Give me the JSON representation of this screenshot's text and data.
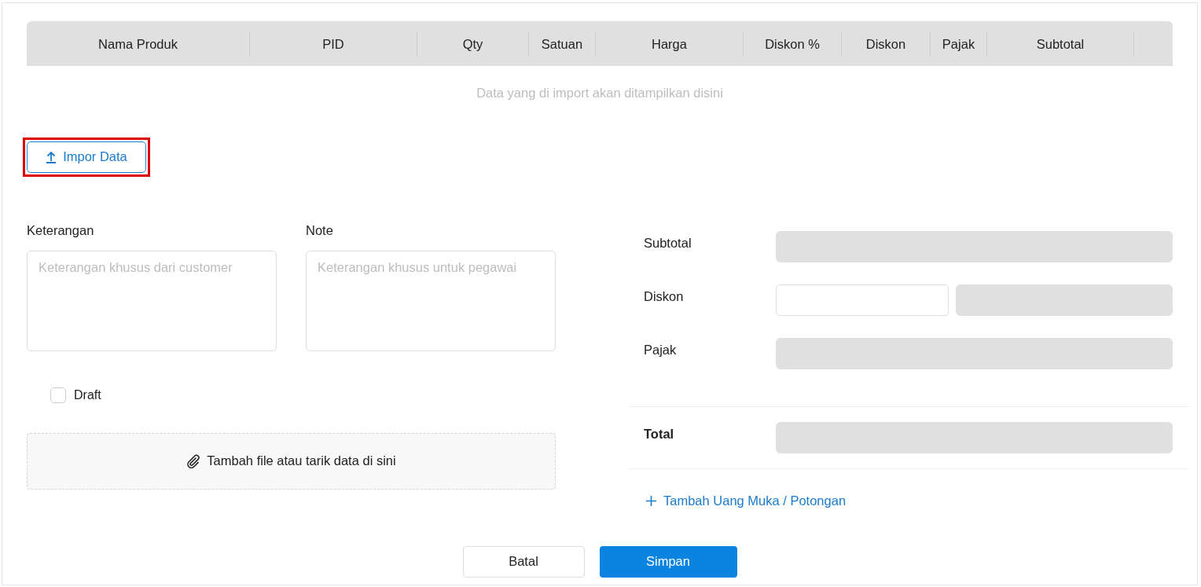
{
  "table": {
    "columns": [
      "Nama Produk",
      "PID",
      "Qty",
      "Satuan",
      "Harga",
      "Diskon %",
      "Diskon",
      "Pajak",
      "Subtotal",
      ""
    ],
    "empty_message": "Data yang di import akan ditampilkan disini"
  },
  "import_button": {
    "label": "Impor Data",
    "highlighted": true
  },
  "keterangan": {
    "label": "Keterangan",
    "placeholder": "Keterangan khusus dari customer"
  },
  "note": {
    "label": "Note",
    "placeholder": "Keterangan khusus untuk pegawai"
  },
  "draft": {
    "label": "Draft",
    "checked": false
  },
  "dropzone": {
    "label": "Tambah file atau tarik data di sini"
  },
  "summary": [
    {
      "label": "Subtotal",
      "kind": "readonly"
    },
    {
      "label": "Diskon",
      "kind": "split"
    },
    {
      "label": "Pajak",
      "kind": "readonly"
    }
  ],
  "total": {
    "label": "Total"
  },
  "add_link": {
    "label": "Tambah Uang Muka / Potongan"
  },
  "buttons": {
    "cancel": "Batal",
    "save": "Simpan"
  }
}
